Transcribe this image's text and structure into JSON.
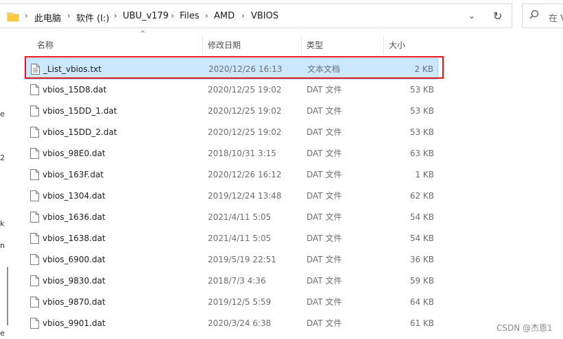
{
  "address_bar": {
    "crumbs": [
      "此电脑",
      "软件 (I:)",
      "UBU_v179",
      "Files",
      "AMD",
      "VBIOS"
    ]
  },
  "search": {
    "placeholder": "在 V"
  },
  "nav_fragments": [
    "e",
    "2",
    "k",
    "n",
    "e"
  ],
  "columns": {
    "name": "名称",
    "date": "修改日期",
    "type": "类型",
    "size": "大小"
  },
  "files": [
    {
      "name": "_List_vbios.txt",
      "date": "2020/12/26 16:13",
      "type": "文本文档",
      "size": "2 KB",
      "icon": "text-file-icon",
      "selected": true
    },
    {
      "name": "vbios_15D8.dat",
      "date": "2020/12/25 19:02",
      "type": "DAT 文件",
      "size": "53 KB",
      "icon": "file-icon"
    },
    {
      "name": "vbios_15DD_1.dat",
      "date": "2020/12/25 19:02",
      "type": "DAT 文件",
      "size": "53 KB",
      "icon": "file-icon"
    },
    {
      "name": "vbios_15DD_2.dat",
      "date": "2020/12/25 19:02",
      "type": "DAT 文件",
      "size": "53 KB",
      "icon": "file-icon"
    },
    {
      "name": "vbios_98E0.dat",
      "date": "2018/10/31 3:15",
      "type": "DAT 文件",
      "size": "63 KB",
      "icon": "file-icon"
    },
    {
      "name": "vbios_163F.dat",
      "date": "2020/12/26 16:12",
      "type": "DAT 文件",
      "size": "1 KB",
      "icon": "file-icon"
    },
    {
      "name": "vbios_1304.dat",
      "date": "2019/12/24 13:48",
      "type": "DAT 文件",
      "size": "62 KB",
      "icon": "file-icon"
    },
    {
      "name": "vbios_1636.dat",
      "date": "2021/4/11 5:05",
      "type": "DAT 文件",
      "size": "54 KB",
      "icon": "file-icon"
    },
    {
      "name": "vbios_1638.dat",
      "date": "2021/4/11 5:05",
      "type": "DAT 文件",
      "size": "54 KB",
      "icon": "file-icon"
    },
    {
      "name": "vbios_6900.dat",
      "date": "2019/5/19 22:51",
      "type": "DAT 文件",
      "size": "36 KB",
      "icon": "file-icon"
    },
    {
      "name": "vbios_9830.dat",
      "date": "2018/7/3 4:36",
      "type": "DAT 文件",
      "size": "59 KB",
      "icon": "file-icon"
    },
    {
      "name": "vbios_9870.dat",
      "date": "2019/12/5 5:59",
      "type": "DAT 文件",
      "size": "64 KB",
      "icon": "file-icon"
    },
    {
      "name": "vbios_9901.dat",
      "date": "2020/3/24 6:38",
      "type": "DAT 文件",
      "size": "61 KB",
      "icon": "file-icon"
    }
  ],
  "highlight_color": "#e8141c",
  "selection_color": "#cce8ff",
  "watermark": "CSDN @杰恩1"
}
